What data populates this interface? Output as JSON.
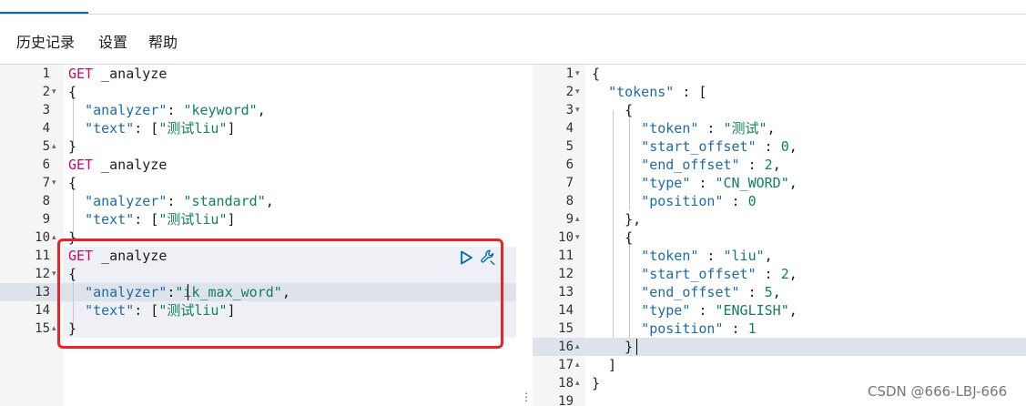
{
  "menu": {
    "history": "历史记录",
    "settings": "设置",
    "help": "帮助"
  },
  "left_editor": {
    "lines": [
      {
        "n": "1",
        "fold": "",
        "tokens": [
          {
            "c": "k-method",
            "t": "GET"
          },
          {
            "c": "",
            "t": " _analyze"
          }
        ]
      },
      {
        "n": "2",
        "fold": "▾",
        "tokens": [
          {
            "c": "",
            "t": "{"
          }
        ]
      },
      {
        "n": "3",
        "fold": "",
        "tokens": [
          {
            "c": "",
            "t": "  "
          },
          {
            "c": "k-prop",
            "t": "\"analyzer\""
          },
          {
            "c": "",
            "t": ": "
          },
          {
            "c": "k-str",
            "t": "\"keyword\""
          },
          {
            "c": "",
            "t": ","
          }
        ]
      },
      {
        "n": "4",
        "fold": "",
        "tokens": [
          {
            "c": "",
            "t": "  "
          },
          {
            "c": "k-prop",
            "t": "\"text\""
          },
          {
            "c": "",
            "t": ": ["
          },
          {
            "c": "k-str",
            "t": "\"测试liu\""
          },
          {
            "c": "",
            "t": "]"
          }
        ]
      },
      {
        "n": "5",
        "fold": "▴",
        "tokens": [
          {
            "c": "",
            "t": "}"
          }
        ]
      },
      {
        "n": "6",
        "fold": "",
        "tokens": [
          {
            "c": "k-method",
            "t": "GET"
          },
          {
            "c": "",
            "t": " _analyze"
          }
        ]
      },
      {
        "n": "7",
        "fold": "▾",
        "tokens": [
          {
            "c": "",
            "t": "{"
          }
        ]
      },
      {
        "n": "8",
        "fold": "",
        "tokens": [
          {
            "c": "",
            "t": "  "
          },
          {
            "c": "k-prop",
            "t": "\"analyzer\""
          },
          {
            "c": "",
            "t": ": "
          },
          {
            "c": "k-str",
            "t": "\"standard\""
          },
          {
            "c": "",
            "t": ","
          }
        ]
      },
      {
        "n": "9",
        "fold": "",
        "tokens": [
          {
            "c": "",
            "t": "  "
          },
          {
            "c": "k-prop",
            "t": "\"text\""
          },
          {
            "c": "",
            "t": ": ["
          },
          {
            "c": "k-str",
            "t": "\"测试liu\""
          },
          {
            "c": "",
            "t": "]"
          }
        ]
      },
      {
        "n": "10",
        "fold": "▴",
        "tokens": [
          {
            "c": "",
            "t": "}"
          }
        ]
      },
      {
        "n": "11",
        "fold": "",
        "tokens": [
          {
            "c": "k-method",
            "t": "GET"
          },
          {
            "c": "",
            "t": " _analyze"
          }
        ]
      },
      {
        "n": "12",
        "fold": "▾",
        "tokens": [
          {
            "c": "",
            "t": "{"
          }
        ]
      },
      {
        "n": "13",
        "fold": "",
        "tokens": [
          {
            "c": "",
            "t": "  "
          },
          {
            "c": "k-prop",
            "t": "\"analyzer\""
          },
          {
            "c": "",
            "t": ":"
          },
          {
            "c": "k-str",
            "t": "\"ik_max_word\""
          },
          {
            "c": "",
            "t": ","
          }
        ]
      },
      {
        "n": "14",
        "fold": "",
        "tokens": [
          {
            "c": "",
            "t": "  "
          },
          {
            "c": "k-prop",
            "t": "\"text\""
          },
          {
            "c": "",
            "t": ": ["
          },
          {
            "c": "k-str",
            "t": "\"测试liu\""
          },
          {
            "c": "",
            "t": "]"
          }
        ]
      },
      {
        "n": "15",
        "fold": "▴",
        "tokens": [
          {
            "c": "",
            "t": "}"
          }
        ]
      }
    ]
  },
  "right_editor": {
    "lines": [
      {
        "n": "1",
        "fold": "▾",
        "tokens": [
          {
            "c": "",
            "t": "{"
          }
        ]
      },
      {
        "n": "2",
        "fold": "▾",
        "tokens": [
          {
            "c": "",
            "t": "  "
          },
          {
            "c": "k-prop",
            "t": "\"tokens\""
          },
          {
            "c": "",
            "t": " : ["
          }
        ]
      },
      {
        "n": "3",
        "fold": "▾",
        "tokens": [
          {
            "c": "",
            "t": "    {"
          }
        ]
      },
      {
        "n": "4",
        "fold": "",
        "tokens": [
          {
            "c": "",
            "t": "      "
          },
          {
            "c": "k-prop",
            "t": "\"token\""
          },
          {
            "c": "",
            "t": " : "
          },
          {
            "c": "k-str",
            "t": "\"测试\""
          },
          {
            "c": "",
            "t": ","
          }
        ]
      },
      {
        "n": "5",
        "fold": "",
        "tokens": [
          {
            "c": "",
            "t": "      "
          },
          {
            "c": "k-prop",
            "t": "\"start_offset\""
          },
          {
            "c": "",
            "t": " : "
          },
          {
            "c": "k-str",
            "t": "0"
          },
          {
            "c": "",
            "t": ","
          }
        ]
      },
      {
        "n": "6",
        "fold": "",
        "tokens": [
          {
            "c": "",
            "t": "      "
          },
          {
            "c": "k-prop",
            "t": "\"end_offset\""
          },
          {
            "c": "",
            "t": " : "
          },
          {
            "c": "k-str",
            "t": "2"
          },
          {
            "c": "",
            "t": ","
          }
        ]
      },
      {
        "n": "7",
        "fold": "",
        "tokens": [
          {
            "c": "",
            "t": "      "
          },
          {
            "c": "k-prop",
            "t": "\"type\""
          },
          {
            "c": "",
            "t": " : "
          },
          {
            "c": "k-str",
            "t": "\"CN_WORD\""
          },
          {
            "c": "",
            "t": ","
          }
        ]
      },
      {
        "n": "8",
        "fold": "",
        "tokens": [
          {
            "c": "",
            "t": "      "
          },
          {
            "c": "k-prop",
            "t": "\"position\""
          },
          {
            "c": "",
            "t": " : "
          },
          {
            "c": "k-str",
            "t": "0"
          }
        ]
      },
      {
        "n": "9",
        "fold": "▴",
        "tokens": [
          {
            "c": "",
            "t": "    },"
          }
        ]
      },
      {
        "n": "10",
        "fold": "▾",
        "tokens": [
          {
            "c": "",
            "t": "    {"
          }
        ]
      },
      {
        "n": "11",
        "fold": "",
        "tokens": [
          {
            "c": "",
            "t": "      "
          },
          {
            "c": "k-prop",
            "t": "\"token\""
          },
          {
            "c": "",
            "t": " : "
          },
          {
            "c": "k-str",
            "t": "\"liu\""
          },
          {
            "c": "",
            "t": ","
          }
        ]
      },
      {
        "n": "12",
        "fold": "",
        "tokens": [
          {
            "c": "",
            "t": "      "
          },
          {
            "c": "k-prop",
            "t": "\"start_offset\""
          },
          {
            "c": "",
            "t": " : "
          },
          {
            "c": "k-str",
            "t": "2"
          },
          {
            "c": "",
            "t": ","
          }
        ]
      },
      {
        "n": "13",
        "fold": "",
        "tokens": [
          {
            "c": "",
            "t": "      "
          },
          {
            "c": "k-prop",
            "t": "\"end_offset\""
          },
          {
            "c": "",
            "t": " : "
          },
          {
            "c": "k-str",
            "t": "5"
          },
          {
            "c": "",
            "t": ","
          }
        ]
      },
      {
        "n": "14",
        "fold": "",
        "tokens": [
          {
            "c": "",
            "t": "      "
          },
          {
            "c": "k-prop",
            "t": "\"type\""
          },
          {
            "c": "",
            "t": " : "
          },
          {
            "c": "k-str",
            "t": "\"ENGLISH\""
          },
          {
            "c": "",
            "t": ","
          }
        ]
      },
      {
        "n": "15",
        "fold": "",
        "tokens": [
          {
            "c": "",
            "t": "      "
          },
          {
            "c": "k-prop",
            "t": "\"position\""
          },
          {
            "c": "",
            "t": " : "
          },
          {
            "c": "k-str",
            "t": "1"
          }
        ]
      },
      {
        "n": "16",
        "fold": "▴",
        "tokens": [
          {
            "c": "",
            "t": "    }"
          }
        ]
      },
      {
        "n": "17",
        "fold": "▴",
        "tokens": [
          {
            "c": "",
            "t": "  ]"
          }
        ]
      },
      {
        "n": "18",
        "fold": "▴",
        "tokens": [
          {
            "c": "",
            "t": "}"
          }
        ]
      },
      {
        "n": "19",
        "fold": "",
        "tokens": []
      }
    ]
  },
  "icons": {
    "run": "play-icon",
    "settings": "wrench-icon",
    "resize": "vertical-dots-icon"
  },
  "divider_glyph": "⋮",
  "watermark": "CSDN @666-LBJ-666",
  "colors": {
    "accent": "#006bb4",
    "highlight_box": "#e4262a",
    "method": "#c80a68",
    "property": "#1f6ba5",
    "string": "#12805c"
  }
}
